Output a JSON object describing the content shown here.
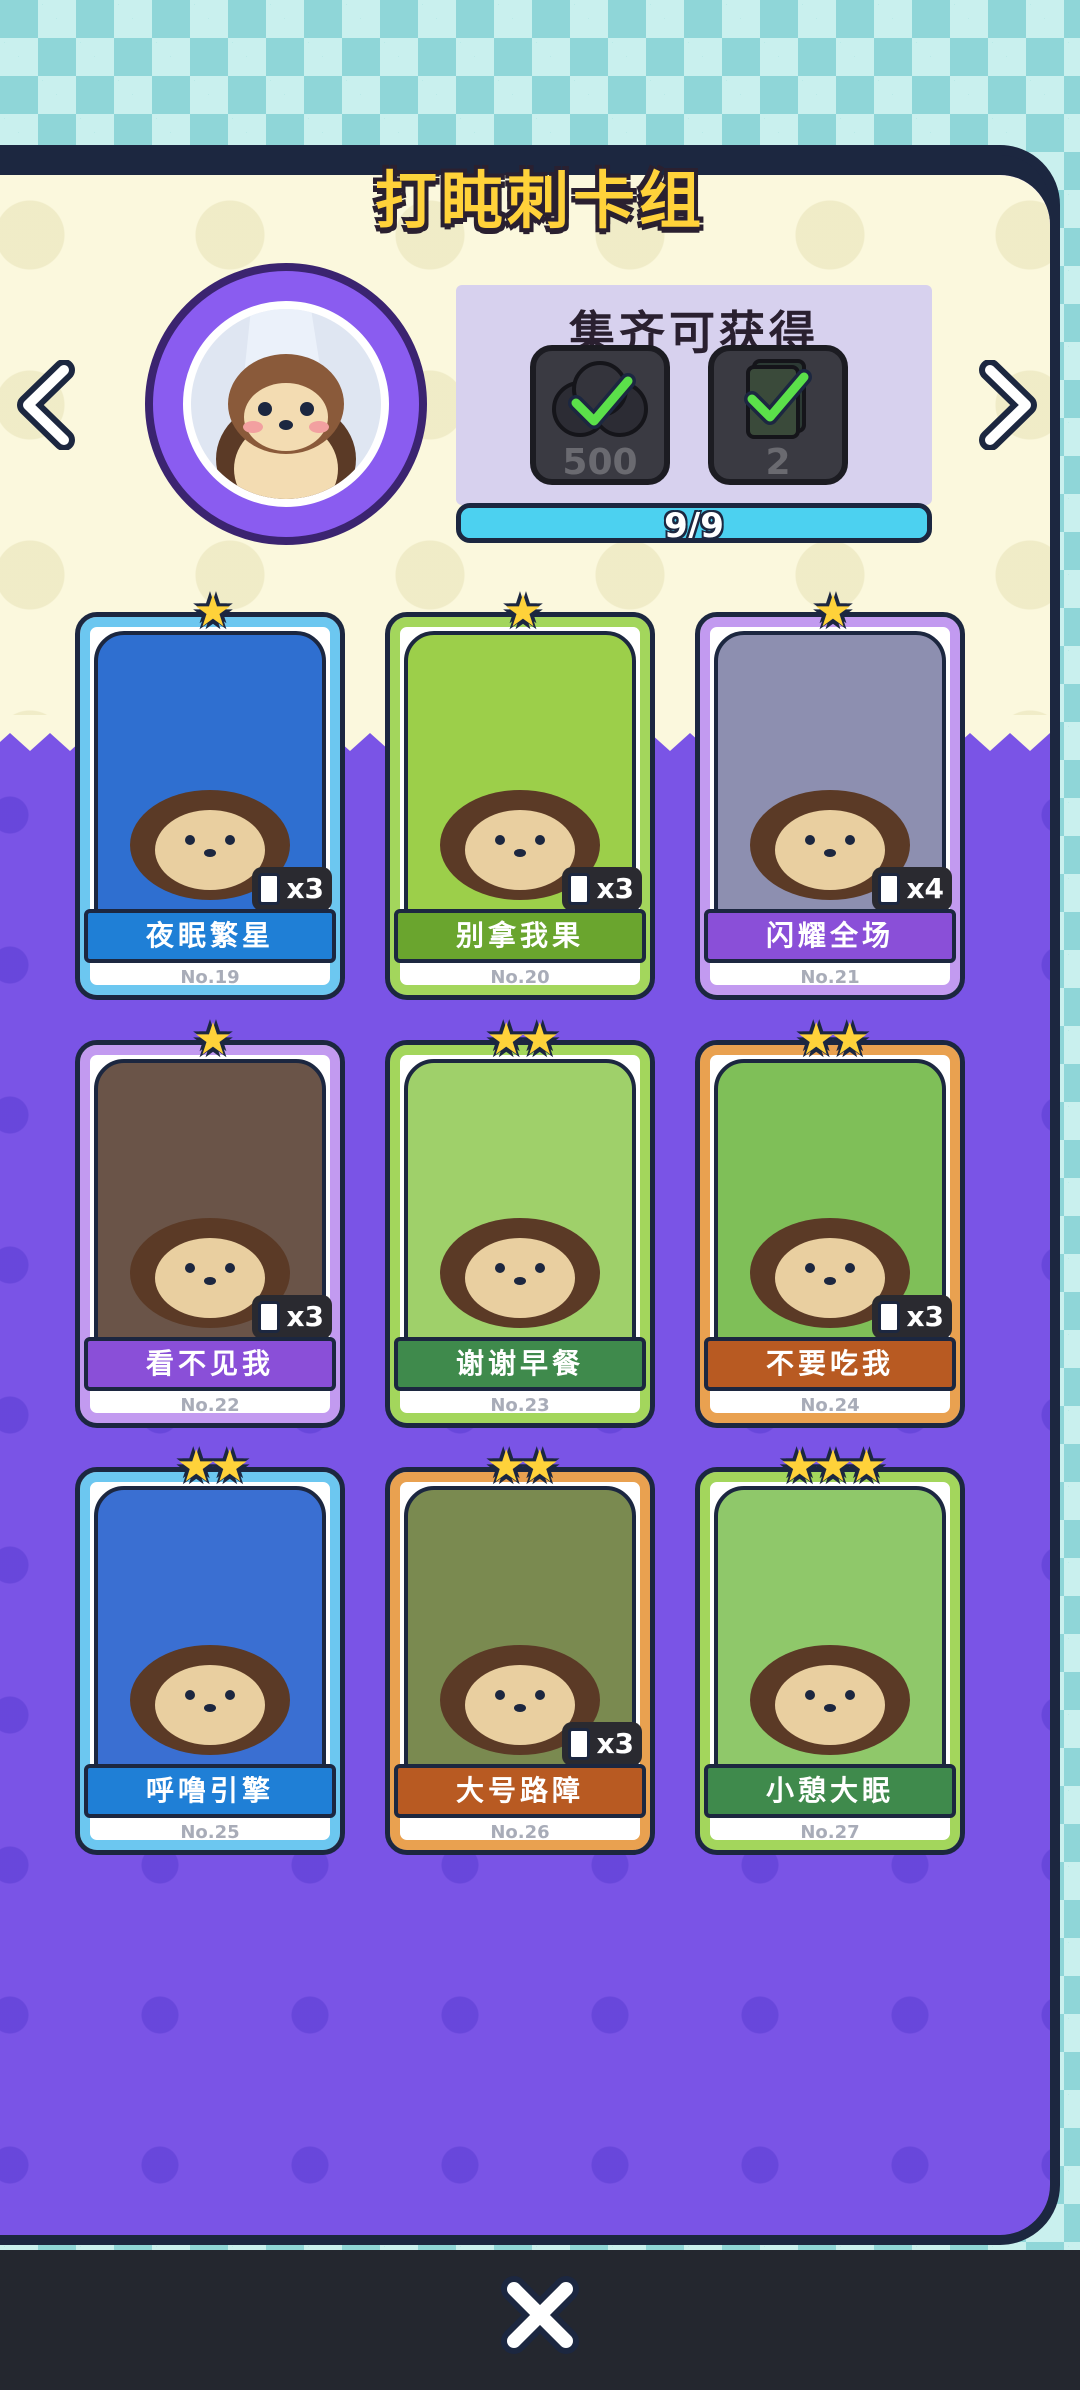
{
  "header": {
    "title": "打盹刺卡组"
  },
  "rewards": {
    "title": "集齐可获得",
    "items": [
      {
        "icon": "coin-pile-icon",
        "value": "500"
      },
      {
        "icon": "card-pack-icon",
        "value": "2"
      }
    ],
    "progress_text": "9/9",
    "progress_fraction": 1.0
  },
  "navigation": {
    "prev_icon": "chevron-left-icon",
    "next_icon": "chevron-right-icon"
  },
  "cards": [
    {
      "name": "夜眠繁星",
      "number": "No.19",
      "stars": "★",
      "count": "x3",
      "ribbon_color": "#1f7fd6",
      "frame_color": "#6cc7f0",
      "art_color": "#2f6fd0"
    },
    {
      "name": "别拿我果",
      "number": "No.20",
      "stars": "★",
      "count": "x3",
      "ribbon_color": "#6aa52e",
      "frame_color": "#a3d65c",
      "art_color": "#9ccf4a"
    },
    {
      "name": "闪耀全场",
      "number": "No.21",
      "stars": "★",
      "count": "x4",
      "ribbon_color": "#8a4fd8",
      "frame_color": "#c29af0",
      "art_color": "#8d8fb0"
    },
    {
      "name": "看不见我",
      "number": "No.22",
      "stars": "★",
      "count": "x3",
      "ribbon_color": "#8a4fd8",
      "frame_color": "#c29af0",
      "art_color": "#6a5448"
    },
    {
      "name": "谢谢早餐",
      "number": "No.23",
      "stars": "★★",
      "count": "",
      "ribbon_color": "#3f8a4c",
      "frame_color": "#a3d65c",
      "art_color": "#9fd06a"
    },
    {
      "name": "不要吃我",
      "number": "No.24",
      "stars": "★★",
      "count": "x3",
      "ribbon_color": "#b85a22",
      "frame_color": "#e9a150",
      "art_color": "#7fbf58"
    },
    {
      "name": "呼噜引擎",
      "number": "No.25",
      "stars": "★★",
      "count": "",
      "ribbon_color": "#1f7fd6",
      "frame_color": "#6cc7f0",
      "art_color": "#3a6fd2"
    },
    {
      "name": "大号路障",
      "number": "No.26",
      "stars": "★★",
      "count": "x3",
      "ribbon_color": "#b85a22",
      "frame_color": "#e9a150",
      "art_color": "#7a8a50"
    },
    {
      "name": "小憩大眠",
      "number": "No.27",
      "stars": "★★★",
      "count": "",
      "ribbon_color": "#3f8a4c",
      "frame_color": "#a3d65c",
      "art_color": "#8fc86a"
    }
  ],
  "footer": {
    "close_icon": "close-icon"
  }
}
